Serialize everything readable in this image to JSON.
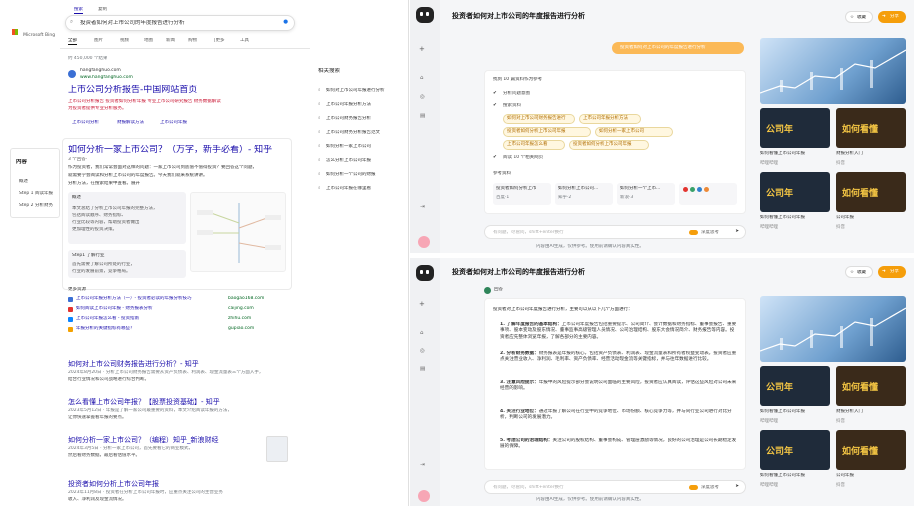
{
  "bing": {
    "logo": "Microsoft Bing",
    "top_tabs": [
      "搜索",
      "复制"
    ],
    "query": "投资者如何对上市公司的年度报告进行分析",
    "nav": [
      "全部",
      "图片",
      "视频",
      "地图",
      "新闻",
      "购物",
      "|更多",
      "工具"
    ],
    "result_count": "约 450,000 个结果",
    "site_name": "hangfanghuo.com",
    "site_url": "www.hangfanghuo.com",
    "r1_title": "上市公司分析报告-中国网站首页",
    "r1_snip1": "上市公司分析报告 投资者如何分析年报 专业上市公司研究报告 财务数据解读",
    "r1_snip2": "为投资者提供专业分析服务。",
    "r1_links": [
      "上市公司分析",
      "财报解读方法",
      "上市公司年报"
    ],
    "side_title": "内容",
    "side_items": [
      "概述",
      "Step 1 阅读年报",
      "Step 2 分析财务"
    ],
    "zh_title": "如何分析一家上市公司？（万字，新手必看）- 知乎",
    "zh_meta": "3 个回答·",
    "zh_snip1": "作为投资者，我们常常会面对这样的问题：一家上市公司到底值不值得投资？要回答这个问题，",
    "zh_snip2": "就需要学会阅读和分析上市公司的年度报告。今天我们就来系统讲讲。",
    "zh_snip3": "分析方法，在搜索结果中查看。展开",
    "step1_label": "概述",
    "step1_text": [
      "本文总结了分析上市公司年报的完整方法，",
      "包括阅读顺序、财务指标、",
      "行业比较等内容，帮助投资者做出",
      "更加理性的投资决策。"
    ],
    "step2_label": "Step1 了解行业",
    "step2_text": [
      "首先需要了解公司所处的行业，",
      "行业的发展前景，竞争格局。"
    ],
    "more_label": "更多资源",
    "more_rows": [
      {
        "text": "上市公司年报分析方法（一）- 投资者必读的年报分析技巧",
        "site": "baogao168.com"
      },
      {
        "text": "如何阅读上市公司年报 - 财务报表分析",
        "site": "caijing.com"
      },
      {
        "text": "上市公司年报怎么看 - 投资指南",
        "site": "zhihu.com"
      },
      {
        "text": "年报分析的关键指标有哪些？",
        "site": "gupiao.com"
      }
    ],
    "results": [
      {
        "title": "如何对上市公司财务报告进行分析？- 知乎",
        "meta": "2024年8月20日 · 分析上市公司财务报告需要从资产负债表、利润表、现金流量表三个方面入手，",
        "snip": "结合行业情况和公司战略进行综合判断。"
      },
      {
        "title": "怎么看懂上市公司年报？【股票投资基础】- 知乎",
        "meta": "2023年5月12日 · 年报是了解一家公司最重要的资料，本文介绍阅读年报的方法，",
        "snip": "让你快速掌握看年报的要点。"
      },
      {
        "title": "如何分析一家上市公司？（编程）知乎_新浪财经",
        "meta": "2024年3月5日 · 分析一家上市公司，首先要看它的商业模式，",
        "snip": "然后看财务数据，最后看估值水平。"
      },
      {
        "title": "投资者如何分析上市公司年报",
        "meta": "2023年11月8日 · 投资者在分析上市公司年报时，应重点关注公司的主营业务",
        "snip": "收入、净利润及现金流情况。"
      }
    ],
    "related_title": "相关搜索",
    "related": [
      "如何对上市公司年报进行分析",
      "上市公司年报分析方法",
      "上市公司财务报告分析",
      "上市公司财务分析报告范文",
      "如何分析一家上市公司",
      "怎么分析上市公司年报",
      "如何分析一个公司的财报",
      "上市公司年报在哪里看"
    ]
  },
  "chat1": {
    "title": "投资者如何对上市公司的年度报告进行分析",
    "btn_collect": "收藏",
    "btn_share": "分享",
    "user_msg": "投资者如何对上市公司的年度报告进行分析",
    "task_title": "找到 10 篇资料作为参考",
    "step_a": "分析问题意图",
    "step_b": "搜索资料",
    "chips": [
      "如何对上市公司财务报告进行",
      "上市公司年报分析方法",
      "投资者如何分析上市公司年报",
      "如何分析一家上市公司",
      "上市公司年报怎么看",
      "投资者如何分析上市公司年报",
      "如何看懂上市公司年报"
    ],
    "step_c": "阅读 10 个相关网页",
    "ref_title": "参考资料",
    "refs": [
      {
        "t": "投资者如何分析上市",
        "s": "百度·1"
      },
      {
        "t": "如何分析上市公司...",
        "s": "知乎·2"
      },
      {
        "t": "如何分析一个上市...",
        "s": "新浪·3"
      }
    ],
    "input_ph": "有问题，尽管问，shift+enter换行",
    "deep": "深度思考",
    "footer": "内容由AI生成，仅供参考。使用前请确认内容真实性。"
  },
  "chat2": {
    "title": "投资者如何对上市公司的年度报告进行分析",
    "btn_collect": "收藏",
    "btn_share": "分享",
    "section": "回答",
    "intro": "投资者对上市公司年度报告进行分析，主要可以从以下几个方面进行：",
    "items": [
      {
        "h": "1. 了解年度报告的基本结构：",
        "t": "上市公司年度报告包括重要提示、公司简介、会计数据和财务指标、董事会报告、重要事项、股本变动及股东情况、董事监事高级管理人员情况、公司治理结构、股东大会情况简介、财务报告等内容。投资者应先整体浏览年报，了解各部分的主要内容。"
      },
      {
        "h": "2. 分析财务数据：",
        "t": "财务报表是年报的核心，包括资产负债表、利润表、现金流量表和所有者权益变动表。投资者应重点关注营业收入、净利润、毛利率、资产负债率、经营活动现金流等关键指标，并与往年数据进行比较。"
      },
      {
        "h": "3. 注意风险提示：",
        "t": "年报中的风险提示部分会说明公司面临的主要风险，投资者应认真阅读，评估这些风险对公司未来经营的影响。"
      },
      {
        "h": "4. 关注行业地位：",
        "t": "通过年报了解公司在行业中的竞争地位、市场份额、核心竞争力等，并与同行业公司进行对比分析，判断公司的发展潜力。"
      },
      {
        "h": "5. 考虑公司的治理结构：",
        "t": "关注公司的股权结构、董事会构成、管理层激励等情况，良好的公司治理是公司长期稳定发展的保障。"
      }
    ],
    "input_ph": "有问题，尽管问，shift+enter换行",
    "deep": "深度思考",
    "footer": "内容由AI生成，仅供参考。使用前请确认内容真实性。"
  },
  "video_cards": [
    {
      "tag": "公司年",
      "cap": "如何看懂上市公司年报",
      "src": "哔哩哔哩"
    },
    {
      "tag": "如何看懂",
      "cap": "财报分析入门",
      "src": "抖音"
    },
    {
      "tag": "公司年",
      "cap": "如何看懂上市公司年报",
      "src": "哔哩哔哩"
    },
    {
      "tag": "如何看懂",
      "cap": "公司年报",
      "src": "抖音"
    }
  ],
  "colors": {
    "brand_red": "#c8102e",
    "chat_orange": "#f59e0b",
    "bing_blue": "#1a0dab"
  }
}
